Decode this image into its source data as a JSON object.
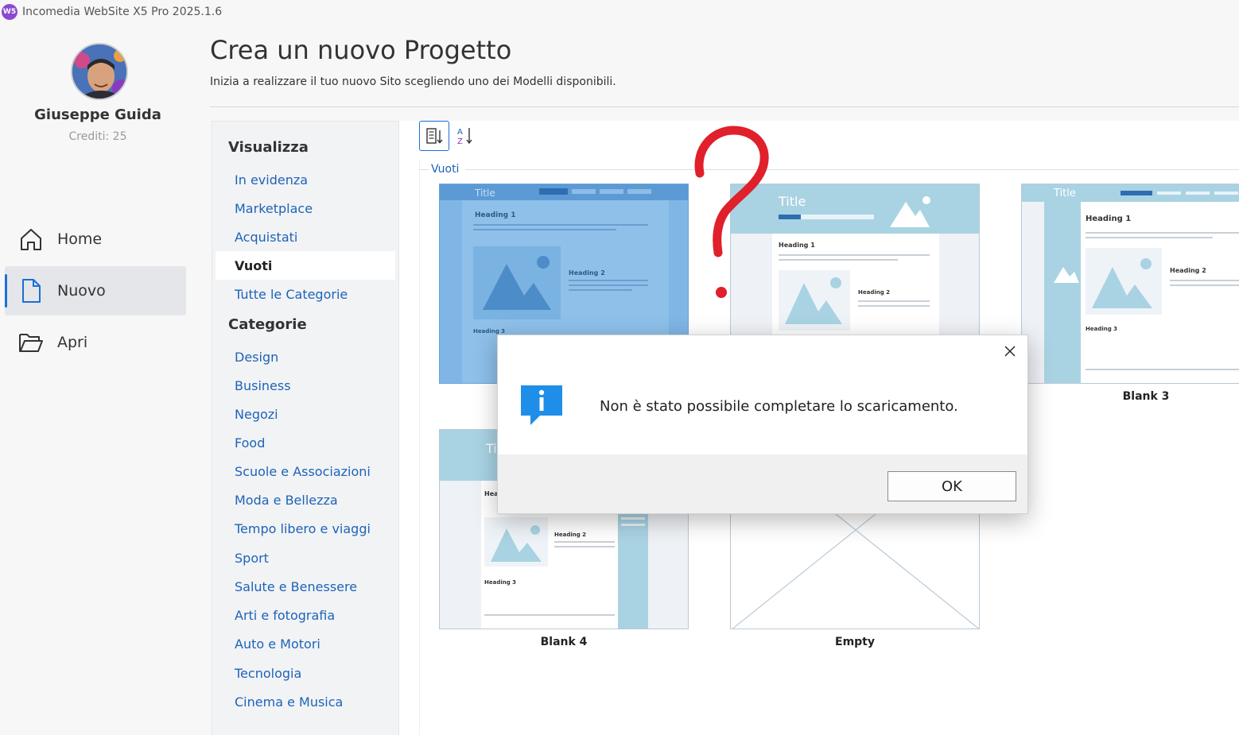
{
  "app": {
    "title": "Incomedia WebSite X5 Pro 2025.1.6",
    "logo_text": "W5"
  },
  "user": {
    "name": "Giuseppe Guida",
    "credits": "Crediti: 25"
  },
  "nav": {
    "home": "Home",
    "new": "Nuovo",
    "open": "Apri"
  },
  "header": {
    "title": "Crea un nuovo Progetto",
    "subtitle": "Inizia a realizzare il tuo nuovo Sito scegliendo uno dei Modelli disponibili."
  },
  "categories": {
    "view_heading": "Visualizza",
    "view_items": [
      "In evidenza",
      "Marketplace",
      "Acquistati",
      "Vuoti",
      "Tutte le Categorie"
    ],
    "active": "Vuoti",
    "cat_heading": "Categorie",
    "cat_items": [
      "Design",
      "Business",
      "Negozi",
      "Food",
      "Scuole e Associazioni",
      "Moda e Bellezza",
      "Tempo libero e viaggi",
      "Sport",
      "Salute e Benessere",
      "Arti e fotografia",
      "Auto e Motori",
      "Tecnologia",
      "Cinema e Musica"
    ]
  },
  "group": {
    "label": "Vuoti"
  },
  "templates": [
    {
      "label": "",
      "thumb_title": "Title",
      "heading1": "Heading 1",
      "heading2": "Heading 2",
      "heading3": "Heading 3"
    },
    {
      "label": "",
      "thumb_title": "Title",
      "heading1": "Heading 1",
      "heading2": "Heading 2",
      "heading3": ""
    },
    {
      "label": "Blank 3",
      "thumb_title": "Title",
      "heading1": "Heading 1",
      "heading2": "Heading 2",
      "heading3": "Heading 3"
    },
    {
      "label": "Blank 4",
      "thumb_title": "Ti",
      "heading1": "Hea",
      "heading2": "Heading 2",
      "heading3": "Heading 3"
    },
    {
      "label": "Empty"
    }
  ],
  "dialog": {
    "message": "Non è stato possibile completare lo scaricamento.",
    "ok_label": "OK"
  },
  "colors": {
    "accent": "#1a6fd6",
    "link": "#1d63b8",
    "annotation": "#e0202a",
    "thumb_blue": "#a9d3e3"
  }
}
